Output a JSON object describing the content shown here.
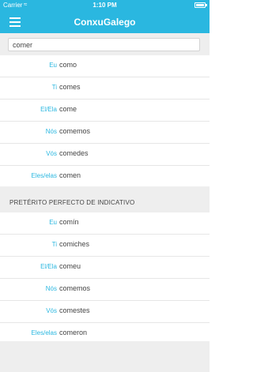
{
  "status_bar": {
    "carrier": "Carrier",
    "time": "1:10 PM"
  },
  "nav": {
    "title": "ConxuGalego",
    "menu_icon": "hamburger-menu-icon"
  },
  "search": {
    "value": "comer",
    "placeholder": ""
  },
  "colors": {
    "accent": "#2ab7e0",
    "background": "#ffffff",
    "section_bg": "#eeeeee"
  },
  "sections": [
    {
      "header": "",
      "rows": [
        {
          "pronoun": "Eu",
          "form": "como"
        },
        {
          "pronoun": "Ti",
          "form": "comes"
        },
        {
          "pronoun": "El/Ela",
          "form": "come"
        },
        {
          "pronoun": "Nós",
          "form": "comemos"
        },
        {
          "pronoun": "Vós",
          "form": "comedes"
        },
        {
          "pronoun": "Eles/elas",
          "form": "comen"
        }
      ]
    },
    {
      "header": "PRETÉRITO PERFECTO DE INDICATIVO",
      "rows": [
        {
          "pronoun": "Eu",
          "form": "comín"
        },
        {
          "pronoun": "Ti",
          "form": "comiches"
        },
        {
          "pronoun": "El/Ela",
          "form": "comeu"
        },
        {
          "pronoun": "Nós",
          "form": "comemos"
        },
        {
          "pronoun": "Vós",
          "form": "comestes"
        },
        {
          "pronoun": "Eles/elas",
          "form": "comeron"
        }
      ]
    }
  ]
}
